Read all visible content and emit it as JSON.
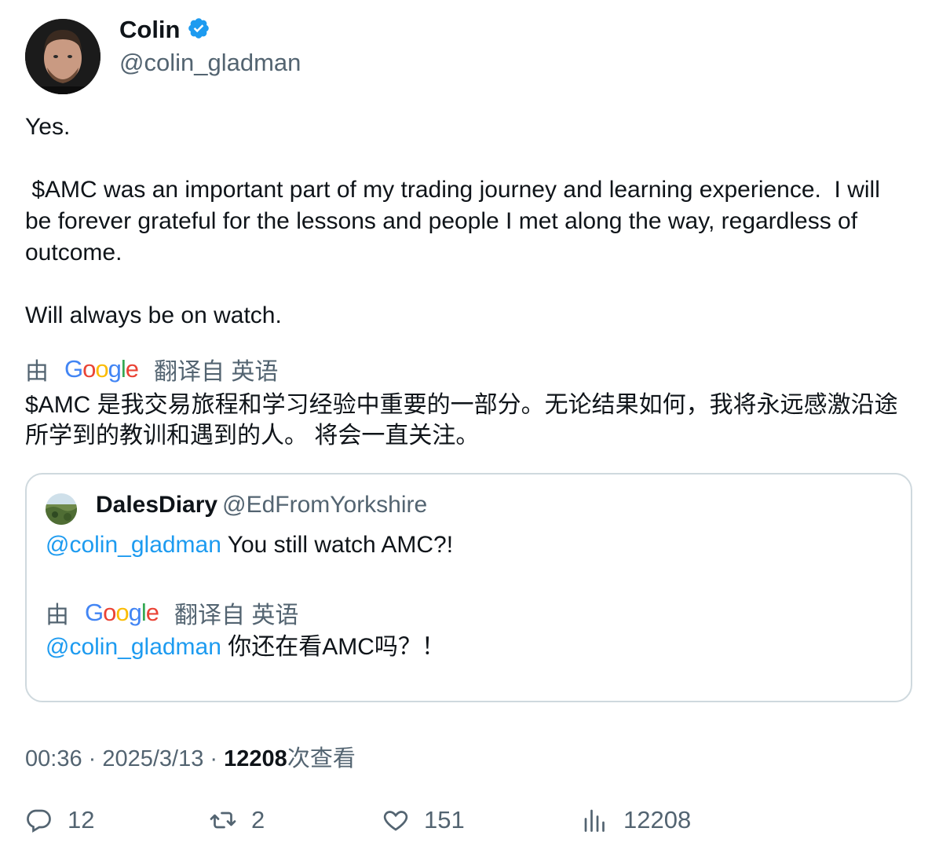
{
  "author": {
    "name": "Colin",
    "handle": "@colin_gladman",
    "verified": true,
    "verified_color": "#1d9bf0"
  },
  "tweet": {
    "text": "Yes.\n\n $AMC was an important part of my trading journey and learning experience.  I will be forever grateful for the lessons and people I met along the way, regardless of outcome.\n\nWill always be on watch.",
    "translation_prefix": "由",
    "translation_brand": "Google",
    "translation_suffix": "翻译自 英语",
    "translated_text": "$AMC 是我交易旅程和学习经验中重要的一部分。无论结果如何，我将永远感激沿途所学到的教训和遇到的人。 将会一直关注。"
  },
  "quoted": {
    "name": "DalesDiary",
    "handle": "@EdFromYorkshire",
    "mention": "@colin_gladman",
    "text": " You still watch AMC?!",
    "translation_prefix": "由",
    "translation_brand": "Google",
    "translation_suffix": "翻译自 英语",
    "translated_mention": "@colin_gladman",
    "translated_text": " 你还在看AMC吗？！"
  },
  "meta": {
    "time": "00:36",
    "sep1": " · ",
    "date": "2025/3/13",
    "sep2": " · ",
    "views_count": "12208",
    "views_label": "次查看"
  },
  "actions": {
    "replies": "12",
    "retweets": "2",
    "likes": "151",
    "views": "12208"
  },
  "colors": {
    "text": "#0f1419",
    "secondary": "#536471",
    "link": "#1d9bf0",
    "border": "#cfd9de"
  }
}
